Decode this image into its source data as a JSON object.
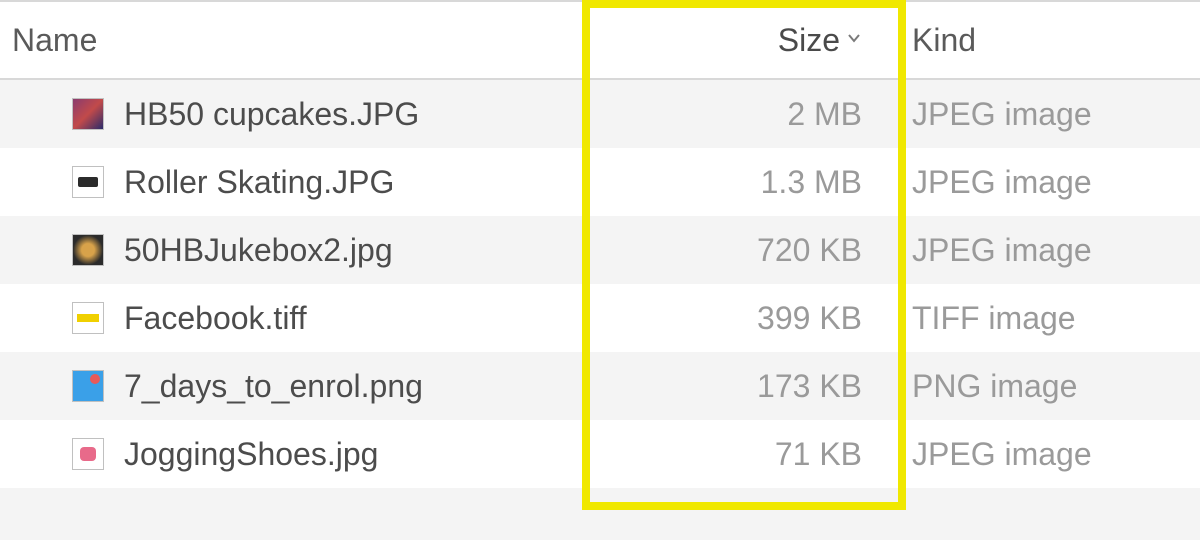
{
  "columns": {
    "name_header": "Name",
    "size_header": "Size",
    "kind_header": "Kind",
    "sorted_column": "size",
    "sort_direction": "descending"
  },
  "files": [
    {
      "name": "HB50 cupcakes.JPG",
      "size": "2 MB",
      "kind": "JPEG image",
      "icon": "thumb-1"
    },
    {
      "name": "Roller Skating.JPG",
      "size": "1.3 MB",
      "kind": "JPEG image",
      "icon": "thumb-2"
    },
    {
      "name": "50HBJukebox2.jpg",
      "size": "720 KB",
      "kind": "JPEG image",
      "icon": "thumb-3"
    },
    {
      "name": "Facebook.tiff",
      "size": "399 KB",
      "kind": "TIFF image",
      "icon": "thumb-4"
    },
    {
      "name": "7_days_to_enrol.png",
      "size": "173 KB",
      "kind": "PNG image",
      "icon": "thumb-5"
    },
    {
      "name": "JoggingShoes.jpg",
      "size": "71 KB",
      "kind": "JPEG image",
      "icon": "thumb-6"
    }
  ],
  "highlight": {
    "column": "size",
    "color": "#f0e800"
  }
}
